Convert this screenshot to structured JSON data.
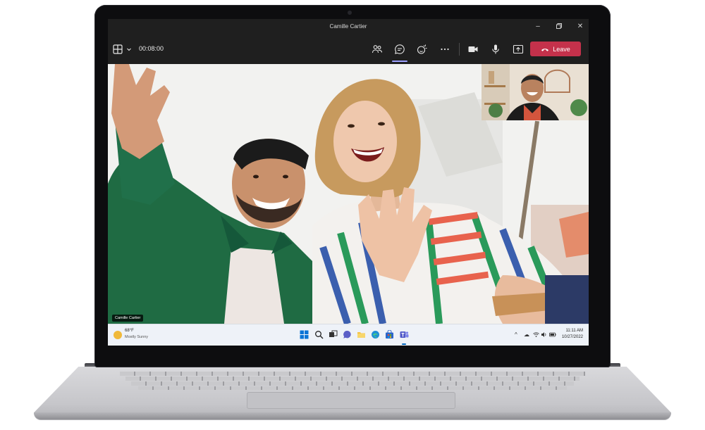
{
  "window": {
    "title": "Camille Cartier"
  },
  "toolbar": {
    "elapsed_time": "00:08:00",
    "leave_label": "Leave",
    "leave_color": "#c4314b",
    "icons": [
      "layout-grid-icon",
      "chevron-down-icon",
      "people-icon",
      "chat-icon",
      "reactions-icon",
      "more-options-icon",
      "camera-icon",
      "microphone-icon",
      "share-screen-icon",
      "hang-up-icon"
    ]
  },
  "stage": {
    "participant_name": "Camille Cartier"
  },
  "taskbar": {
    "weather": {
      "temperature": "68°F",
      "condition": "Mostly Sunny"
    },
    "apps": [
      "start-icon",
      "search-icon",
      "task-view-icon",
      "chat-app-icon",
      "file-explorer-icon",
      "edge-icon",
      "store-icon",
      "teams-icon"
    ],
    "tray": {
      "time": "11:11 AM",
      "date": "10/27/2022"
    }
  }
}
